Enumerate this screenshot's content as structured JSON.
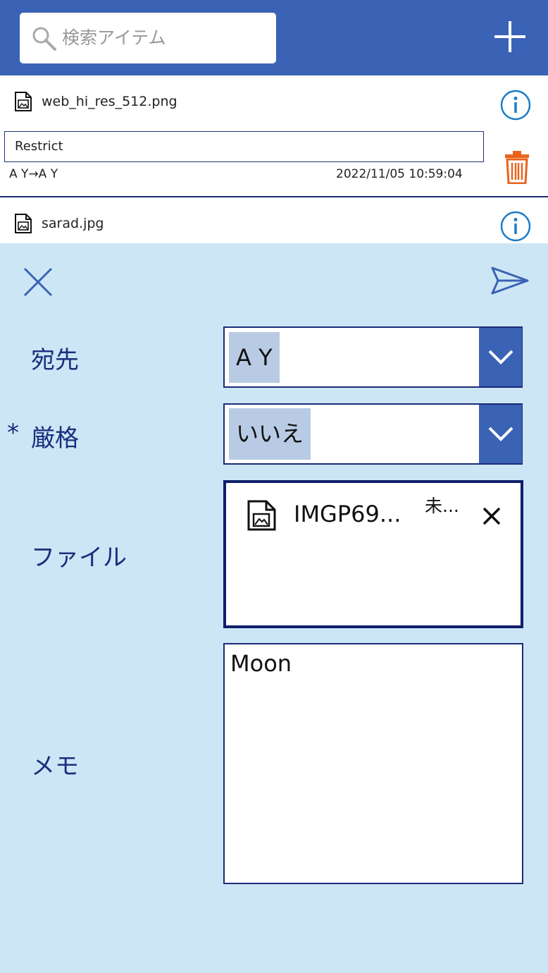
{
  "search": {
    "placeholder": "検索アイテム",
    "value": ""
  },
  "list": {
    "items": [
      {
        "filename": "web_hi_res_512.png",
        "comment": "Restrict",
        "route": "A Y→A Y",
        "timestamp": "2022/11/05 10:59:04"
      },
      {
        "filename": "sarad.jpg"
      }
    ]
  },
  "form": {
    "fields": {
      "recipient": {
        "label": "宛先",
        "value": "A Y"
      },
      "strict": {
        "required_mark": "*",
        "label": "厳格",
        "value": "いいえ"
      },
      "file": {
        "label": "ファイル",
        "attachment": {
          "name": "IMGP69...",
          "status": "未..."
        }
      },
      "memo": {
        "label": "メモ",
        "value": "Moon"
      }
    }
  },
  "colors": {
    "header": "#3a62b5",
    "panel": "#cde6f5",
    "label": "#1a2f7e",
    "info_icon": "#1a7cc8",
    "trash_icon": "#e8641c"
  },
  "icons": [
    "search-icon",
    "plus-icon",
    "image-file-icon",
    "info-icon",
    "trash-icon",
    "close-icon",
    "send-icon",
    "chevron-down-icon",
    "remove-icon"
  ]
}
